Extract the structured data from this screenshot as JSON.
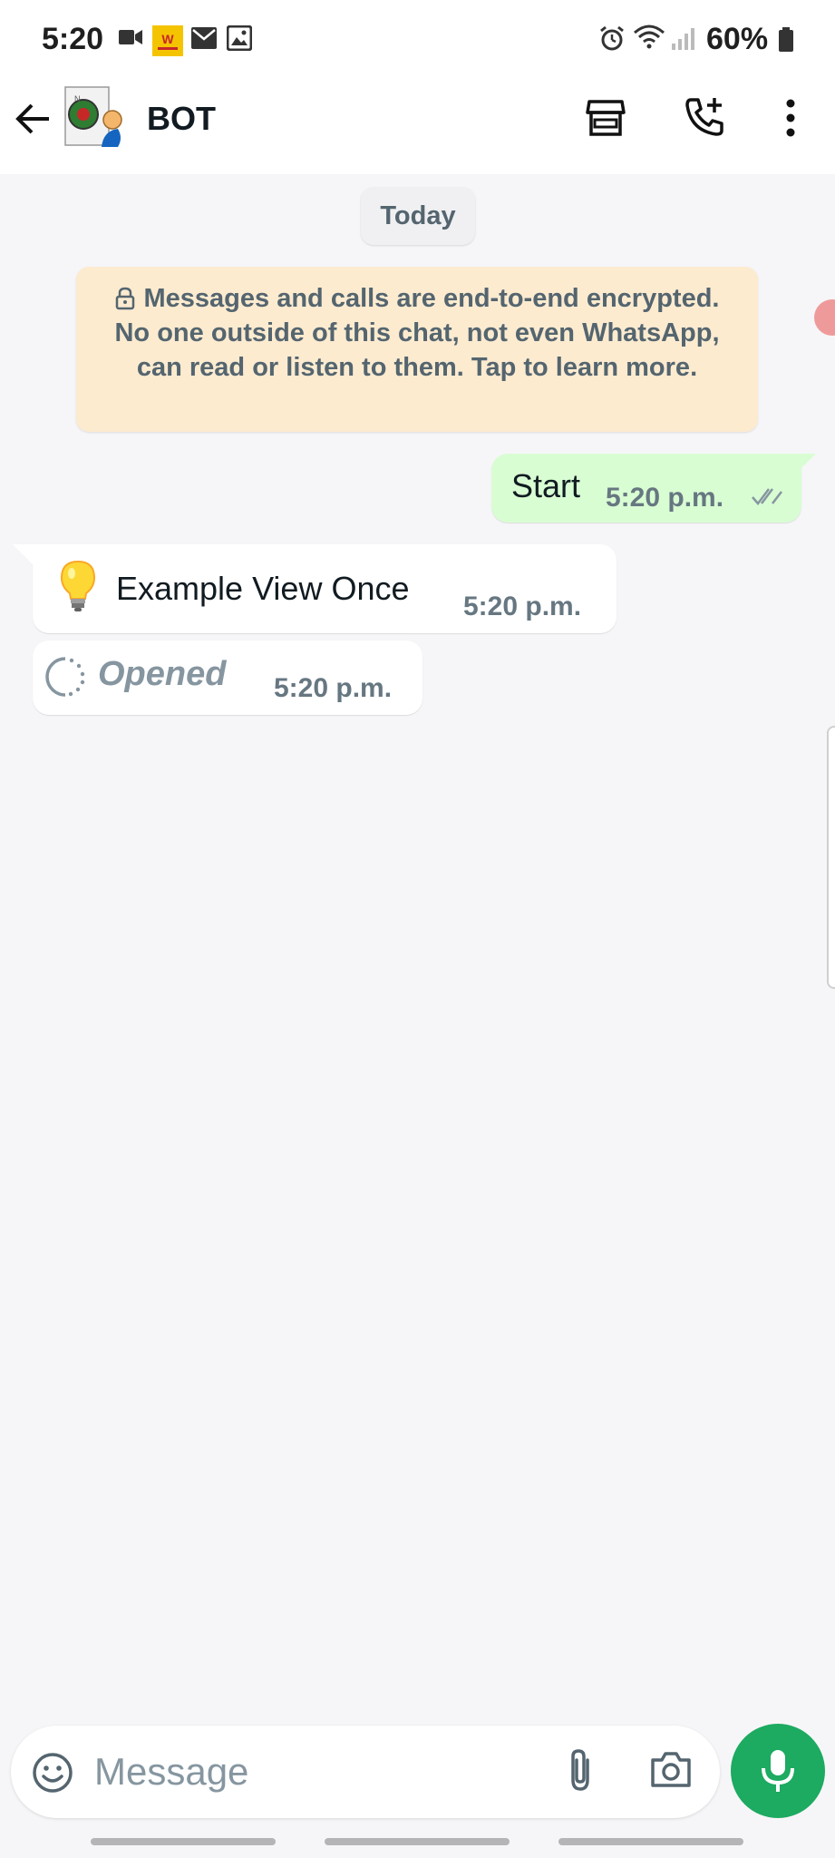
{
  "status_bar": {
    "time": "5:20",
    "battery": "60%",
    "icons": [
      "video-camera-icon",
      "app-notification-icon",
      "mail-icon",
      "image-icon",
      "alarm-icon",
      "wifi-icon",
      "signal-icon",
      "battery-icon"
    ]
  },
  "header": {
    "title": "BOT",
    "icons": [
      "back-arrow-icon",
      "avatar",
      "store-icon",
      "add-call-icon",
      "more-options-icon"
    ]
  },
  "chat": {
    "date_label": "Today",
    "encryption_notice": "Messages and calls are end-to-end encrypted. No one outside of this chat, not even WhatsApp, can read or listen to them. Tap to learn more.",
    "messages": [
      {
        "direction": "outgoing",
        "text": "Start",
        "time": "5:20 p.m.",
        "status": "read-ticks"
      },
      {
        "direction": "incoming",
        "emoji": "💡",
        "text": "Example View Once",
        "time": "5:20 p.m."
      },
      {
        "direction": "incoming",
        "text": "Opened",
        "time": "5:20 p.m.",
        "type": "view-once-opened"
      }
    ]
  },
  "composer": {
    "placeholder": "Message"
  },
  "colors": {
    "outgoing_bubble": "#d9fdd3",
    "incoming_bubble": "#ffffff",
    "encryption_bg": "#fdebd0",
    "mic_button": "#1daa61",
    "chat_background": "#f6f6f8"
  }
}
